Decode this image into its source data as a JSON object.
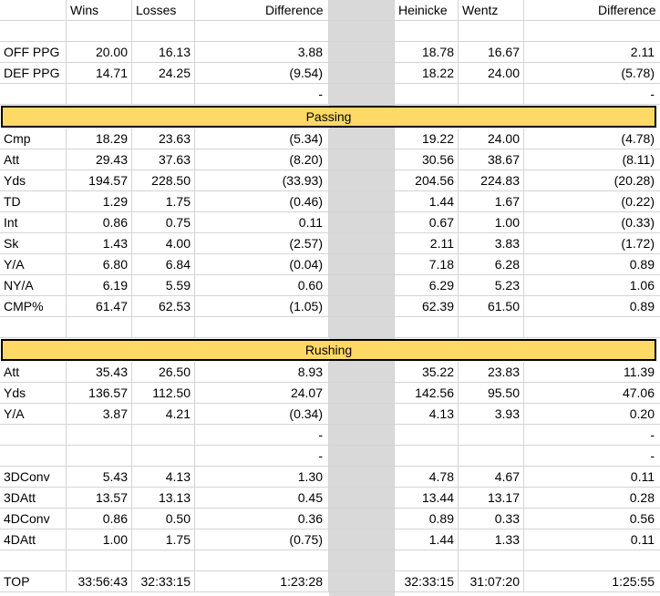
{
  "headers": [
    "",
    "Wins",
    "Losses",
    "Difference",
    "",
    "Heinicke",
    "Wentz",
    "Difference"
  ],
  "sections": [
    {
      "type": "blank"
    },
    {
      "type": "row",
      "cells": [
        "OFF PPG",
        "20.00",
        "16.13",
        "3.88",
        "",
        "18.78",
        "16.67",
        "2.11"
      ]
    },
    {
      "type": "row",
      "cells": [
        "DEF PPG",
        "14.71",
        "24.25",
        "(9.54)",
        "",
        "18.22",
        "24.00",
        "(5.78)"
      ]
    },
    {
      "type": "row",
      "cells": [
        "",
        "",
        "",
        "-",
        "",
        "",
        "",
        "-"
      ]
    },
    {
      "type": "band",
      "label": "Passing"
    },
    {
      "type": "row",
      "cells": [
        "Cmp",
        "18.29",
        "23.63",
        "(5.34)",
        "",
        "19.22",
        "24.00",
        "(4.78)"
      ]
    },
    {
      "type": "row",
      "cells": [
        "Att",
        "29.43",
        "37.63",
        "(8.20)",
        "",
        "30.56",
        "38.67",
        "(8.11)"
      ]
    },
    {
      "type": "row",
      "cells": [
        "Yds",
        "194.57",
        "228.50",
        "(33.93)",
        "",
        "204.56",
        "224.83",
        "(20.28)"
      ]
    },
    {
      "type": "row",
      "cells": [
        "TD",
        "1.29",
        "1.75",
        "(0.46)",
        "",
        "1.44",
        "1.67",
        "(0.22)"
      ]
    },
    {
      "type": "row",
      "cells": [
        "Int",
        "0.86",
        "0.75",
        "0.11",
        "",
        "0.67",
        "1.00",
        "(0.33)"
      ]
    },
    {
      "type": "row",
      "cells": [
        "Sk",
        "1.43",
        "4.00",
        "(2.57)",
        "",
        "2.11",
        "3.83",
        "(1.72)"
      ]
    },
    {
      "type": "row",
      "cells": [
        "Y/A",
        "6.80",
        "6.84",
        "(0.04)",
        "",
        "7.18",
        "6.28",
        "0.89"
      ]
    },
    {
      "type": "row",
      "cells": [
        "NY/A",
        "6.19",
        "5.59",
        "0.60",
        "",
        "6.29",
        "5.23",
        "1.06"
      ]
    },
    {
      "type": "row",
      "cells": [
        "CMP%",
        "61.47",
        "62.53",
        "(1.05)",
        "",
        "62.39",
        "61.50",
        "0.89"
      ]
    },
    {
      "type": "blank"
    },
    {
      "type": "band",
      "label": "Rushing"
    },
    {
      "type": "row",
      "cells": [
        "Att",
        "35.43",
        "26.50",
        "8.93",
        "",
        "35.22",
        "23.83",
        "11.39"
      ]
    },
    {
      "type": "row",
      "cells": [
        "Yds",
        "136.57",
        "112.50",
        "24.07",
        "",
        "142.56",
        "95.50",
        "47.06"
      ]
    },
    {
      "type": "row",
      "cells": [
        "Y/A",
        "3.87",
        "4.21",
        "(0.34)",
        "",
        "4.13",
        "3.93",
        "0.20"
      ]
    },
    {
      "type": "row",
      "cells": [
        "",
        "",
        "",
        "-",
        "",
        "",
        "",
        "-"
      ]
    },
    {
      "type": "row",
      "cells": [
        "",
        "",
        "",
        "-",
        "",
        "",
        "",
        "-"
      ]
    },
    {
      "type": "row",
      "cells": [
        "3DConv",
        "5.43",
        "4.13",
        "1.30",
        "",
        "4.78",
        "4.67",
        "0.11"
      ]
    },
    {
      "type": "row",
      "cells": [
        "3DAtt",
        "13.57",
        "13.13",
        "0.45",
        "",
        "13.44",
        "13.17",
        "0.28"
      ]
    },
    {
      "type": "row",
      "cells": [
        "4DConv",
        "0.86",
        "0.50",
        "0.36",
        "",
        "0.89",
        "0.33",
        "0.56"
      ]
    },
    {
      "type": "row",
      "cells": [
        "4DAtt",
        "1.00",
        "1.75",
        "(0.75)",
        "",
        "1.44",
        "1.33",
        "0.11"
      ]
    },
    {
      "type": "blank"
    },
    {
      "type": "row",
      "cells": [
        "TOP",
        "33:56:43",
        "32:33:15",
        "1:23:28",
        "",
        "32:33:15",
        "31:07:20",
        "1:25:55"
      ]
    }
  ]
}
